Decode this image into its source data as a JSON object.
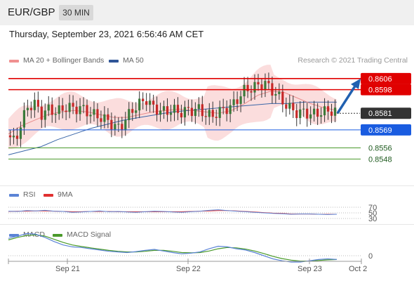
{
  "header": {
    "pair": "EUR/GBP",
    "timeframe": "30 MIN"
  },
  "datetime": "Thursday, September 23, 2021 6:56:46 AM CET",
  "legend": {
    "ma20_label": "MA 20 + Bollinger Bands",
    "ma50_label": "MA 50",
    "rsi_label": "RSI",
    "rsi9_label": "9MA",
    "macd_label": "MACD",
    "macd_signal_label": "MACD Signal",
    "credit": "Research © 2021 Trading Central"
  },
  "x_axis": {
    "labels": [
      "Sep 21",
      "Sep 22",
      "Sep 23",
      "Oct 2"
    ]
  },
  "chart_data": [
    {
      "type": "line",
      "title": "EUR/GBP 30 MIN",
      "price_range": [
        0.8535,
        0.8612
      ],
      "levels": [
        {
          "label": "0.8606",
          "value": 0.8606,
          "color": "#e00000",
          "kind": "resistance"
        },
        {
          "label": "0.8598",
          "value": 0.8598,
          "color": "#e00000",
          "kind": "resistance"
        },
        {
          "label": "0.8581",
          "value": 0.8581,
          "color": "#333333",
          "kind": "last"
        },
        {
          "label": "0.8569",
          "value": 0.8569,
          "color": "#1a5ce0",
          "kind": "pivot"
        },
        {
          "label": "0.8556",
          "value": 0.8556,
          "color": "#4a9a2a",
          "kind": "support"
        },
        {
          "label": "0.8548",
          "value": 0.8548,
          "color": "#4a9a2a",
          "kind": "support"
        }
      ],
      "price_path": [
        0.8565,
        0.856,
        0.8575,
        0.8586,
        0.8588,
        0.858,
        0.8584,
        0.8582,
        0.8583,
        0.8586,
        0.8584,
        0.8585,
        0.8582,
        0.858,
        0.8578,
        0.8576,
        0.8572,
        0.857,
        0.8578,
        0.8584,
        0.8588,
        0.8591,
        0.8585,
        0.8583,
        0.8582,
        0.8584,
        0.8581,
        0.8583,
        0.8583,
        0.8584,
        0.858,
        0.8579,
        0.8582,
        0.8584,
        0.8586,
        0.8592,
        0.8598,
        0.8599,
        0.8601,
        0.8603,
        0.8598,
        0.8594,
        0.8588,
        0.8584,
        0.8581,
        0.8582,
        0.858,
        0.8581,
        0.8582,
        0.8583,
        0.8582
      ],
      "ma50_path": [
        0.8551,
        0.8554,
        0.8557,
        0.8562,
        0.8566,
        0.857,
        0.8573,
        0.8576,
        0.8578,
        0.858,
        0.8582,
        0.8583,
        0.8584,
        0.8585,
        0.8586,
        0.8587,
        0.8588,
        0.8588,
        0.8589,
        0.8589,
        0.8589
      ],
      "ma20_path": [
        0.8566,
        0.8572,
        0.8576,
        0.858,
        0.8582,
        0.8583,
        0.8582,
        0.858,
        0.8578,
        0.8578,
        0.858,
        0.8582,
        0.8583,
        0.8584,
        0.8583,
        0.8582,
        0.8581,
        0.8583,
        0.8588,
        0.8594,
        0.8597,
        0.8596,
        0.8592,
        0.8588,
        0.8585,
        0.8583
      ],
      "forecast_arrow": {
        "from": 0.8581,
        "to": 0.8606,
        "color": "#2060b0"
      },
      "colors": {
        "bull": "#3a7a3a",
        "bear": "#c62828",
        "band": "#f9c6c6",
        "ma20": "#e98d8d",
        "ma50": "#3a66a8"
      }
    },
    {
      "type": "line",
      "title": "RSI",
      "y_ticks": [
        "70",
        "50",
        "30"
      ],
      "rsi_path": [
        56,
        55,
        58,
        57,
        59,
        56,
        55,
        52,
        53,
        55,
        57,
        54,
        55,
        53,
        52,
        54,
        56,
        55,
        53,
        52,
        54,
        56,
        59,
        61,
        58,
        56,
        54,
        52,
        50,
        48,
        47,
        45,
        46,
        46,
        45,
        44,
        45
      ],
      "rsi_ma_path": [
        55,
        56,
        56,
        57,
        57,
        56,
        55,
        54,
        54,
        55,
        55,
        55,
        54,
        54,
        54,
        54,
        54,
        54,
        54,
        54,
        55,
        56,
        57,
        58,
        58,
        57,
        55,
        53,
        51,
        49,
        48,
        46,
        46,
        46,
        45,
        45,
        45
      ],
      "colors": {
        "rsi": "#5b84d6",
        "ma": "#e03030"
      }
    },
    {
      "type": "line",
      "title": "MACD",
      "y_ticks": [
        "0"
      ],
      "macd_path": [
        0.00055,
        0.00062,
        0.0007,
        0.00068,
        0.00058,
        0.00045,
        0.00034,
        0.00028,
        0.00026,
        0.00022,
        0.00018,
        0.00014,
        0.00012,
        0.0001,
        0.00013,
        0.00017,
        0.0002,
        0.00015,
        0.0001,
        6e-05,
        8e-05,
        0.00012,
        0.00022,
        0.0003,
        0.00028,
        0.00022,
        0.00018,
        0.0001,
        0.0,
        -0.0001,
        -0.00016,
        -0.0002,
        -0.0002,
        -0.00016,
        -0.00012,
        -0.0001,
        -0.00012
      ],
      "signal_path": [
        0.0005,
        0.00058,
        0.00064,
        0.00066,
        0.00062,
        0.00052,
        0.00042,
        0.00034,
        0.00029,
        0.00025,
        0.00021,
        0.00017,
        0.00014,
        0.00012,
        0.00012,
        0.00014,
        0.00017,
        0.00017,
        0.00014,
        0.0001,
        9e-05,
        0.0001,
        0.00015,
        0.00022,
        0.00026,
        0.00025,
        0.00021,
        0.00015,
        7e-05,
        -2e-05,
        -9e-05,
        -0.00014,
        -0.00017,
        -0.00017,
        -0.00015,
        -0.00013,
        -0.00012
      ],
      "colors": {
        "macd": "#5b84d6",
        "signal": "#4a9a2a"
      }
    }
  ]
}
